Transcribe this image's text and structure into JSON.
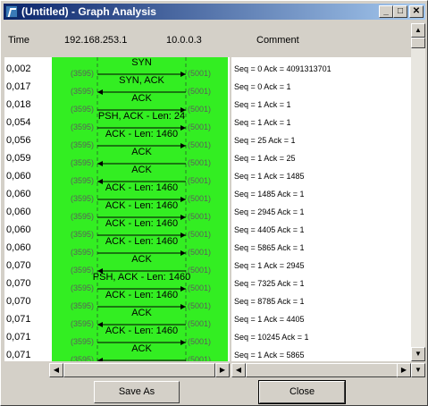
{
  "window": {
    "title": "(Untitled) - Graph Analysis"
  },
  "title_buttons": {
    "minimize": "_",
    "maximize": "□",
    "close": "✕"
  },
  "header": {
    "time": "Time",
    "host_a": "192.168.253.1",
    "host_b": "10.0.0.3",
    "comment": "Comment"
  },
  "rows": [
    {
      "time": "0,002",
      "label": "SYN",
      "dir": "right",
      "comment": "Seq = 0 Ack = 4091313701"
    },
    {
      "time": "0,017",
      "label": "SYN, ACK",
      "dir": "left",
      "comment": "Seq = 0 Ack = 1"
    },
    {
      "time": "0,018",
      "label": "ACK",
      "dir": "right",
      "comment": "Seq = 1 Ack = 1"
    },
    {
      "time": "0,054",
      "label": "PSH, ACK - Len: 24",
      "dir": "right",
      "comment": "Seq = 1 Ack = 1"
    },
    {
      "time": "0,056",
      "label": "ACK - Len: 1460",
      "dir": "right",
      "comment": "Seq = 25 Ack = 1"
    },
    {
      "time": "0,059",
      "label": "ACK",
      "dir": "left",
      "comment": "Seq = 1 Ack = 25"
    },
    {
      "time": "0,060",
      "label": "ACK",
      "dir": "left",
      "comment": "Seq = 1 Ack = 1485"
    },
    {
      "time": "0,060",
      "label": "ACK - Len: 1460",
      "dir": "right",
      "comment": "Seq = 1485 Ack = 1"
    },
    {
      "time": "0,060",
      "label": "ACK - Len: 1460",
      "dir": "right",
      "comment": "Seq = 2945 Ack = 1"
    },
    {
      "time": "0,060",
      "label": "ACK - Len: 1460",
      "dir": "right",
      "comment": "Seq = 4405 Ack = 1"
    },
    {
      "time": "0,060",
      "label": "ACK - Len: 1460",
      "dir": "right",
      "comment": "Seq = 5865 Ack = 1"
    },
    {
      "time": "0,070",
      "label": "ACK",
      "dir": "left",
      "comment": "Seq = 1 Ack = 2945"
    },
    {
      "time": "0,070",
      "label": "PSH, ACK - Len: 1460",
      "dir": "right",
      "comment": "Seq = 7325 Ack = 1"
    },
    {
      "time": "0,070",
      "label": "ACK - Len: 1460",
      "dir": "right",
      "comment": "Seq = 8785 Ack = 1"
    },
    {
      "time": "0,071",
      "label": "ACK",
      "dir": "left",
      "comment": "Seq = 1 Ack = 4405"
    },
    {
      "time": "0,071",
      "label": "ACK - Len: 1460",
      "dir": "right",
      "comment": "Seq = 10245 Ack = 1"
    },
    {
      "time": "0,071",
      "label": "ACK",
      "dir": "left",
      "comment": "Seq = 1 Ack = 5865"
    }
  ],
  "ports": {
    "left": "(3595)",
    "right": "(5001)"
  },
  "scroll_arrows": {
    "up": "▲",
    "down": "▼",
    "left": "◀",
    "right": "▶"
  },
  "buttons": {
    "save_as": "Save As",
    "close": "Close"
  }
}
